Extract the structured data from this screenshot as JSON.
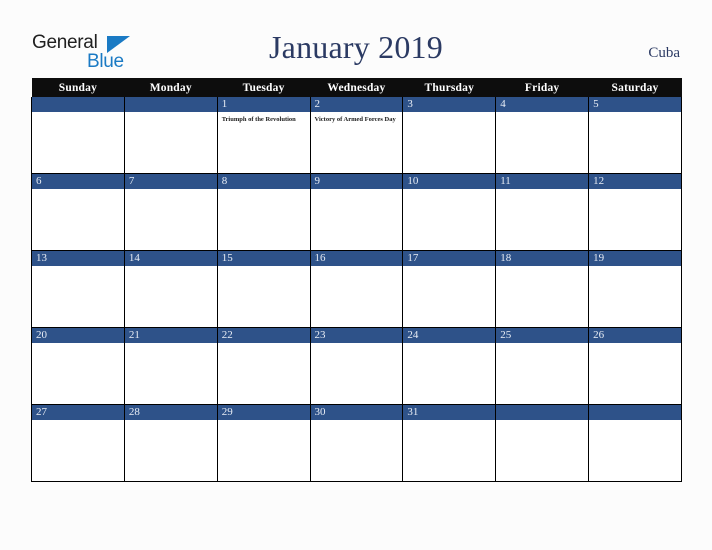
{
  "brand": {
    "name_part1": "General",
    "name_part2": "Blue",
    "logo_icon": "blue-triangle-icon"
  },
  "header": {
    "title": "January 2019",
    "region": "Cuba"
  },
  "colors": {
    "header_bar": "#0d0d0d",
    "day_bar": "#2e5289",
    "title_text": "#2b3a63",
    "brand_blue": "#1a7ac4",
    "page_background": "#fcfcfc"
  },
  "calendar": {
    "weekday_headers": [
      "Sunday",
      "Monday",
      "Tuesday",
      "Wednesday",
      "Thursday",
      "Friday",
      "Saturday"
    ],
    "weeks": [
      [
        {
          "day": "",
          "events": []
        },
        {
          "day": "",
          "events": []
        },
        {
          "day": "1",
          "events": [
            "Triumph of the Revolution"
          ]
        },
        {
          "day": "2",
          "events": [
            "Victory of Armed Forces Day"
          ]
        },
        {
          "day": "3",
          "events": []
        },
        {
          "day": "4",
          "events": []
        },
        {
          "day": "5",
          "events": []
        }
      ],
      [
        {
          "day": "6",
          "events": []
        },
        {
          "day": "7",
          "events": []
        },
        {
          "day": "8",
          "events": []
        },
        {
          "day": "9",
          "events": []
        },
        {
          "day": "10",
          "events": []
        },
        {
          "day": "11",
          "events": []
        },
        {
          "day": "12",
          "events": []
        }
      ],
      [
        {
          "day": "13",
          "events": []
        },
        {
          "day": "14",
          "events": []
        },
        {
          "day": "15",
          "events": []
        },
        {
          "day": "16",
          "events": []
        },
        {
          "day": "17",
          "events": []
        },
        {
          "day": "18",
          "events": []
        },
        {
          "day": "19",
          "events": []
        }
      ],
      [
        {
          "day": "20",
          "events": []
        },
        {
          "day": "21",
          "events": []
        },
        {
          "day": "22",
          "events": []
        },
        {
          "day": "23",
          "events": []
        },
        {
          "day": "24",
          "events": []
        },
        {
          "day": "25",
          "events": []
        },
        {
          "day": "26",
          "events": []
        }
      ],
      [
        {
          "day": "27",
          "events": []
        },
        {
          "day": "28",
          "events": []
        },
        {
          "day": "29",
          "events": []
        },
        {
          "day": "30",
          "events": []
        },
        {
          "day": "31",
          "events": []
        },
        {
          "day": "",
          "events": []
        },
        {
          "day": "",
          "events": []
        }
      ]
    ]
  }
}
